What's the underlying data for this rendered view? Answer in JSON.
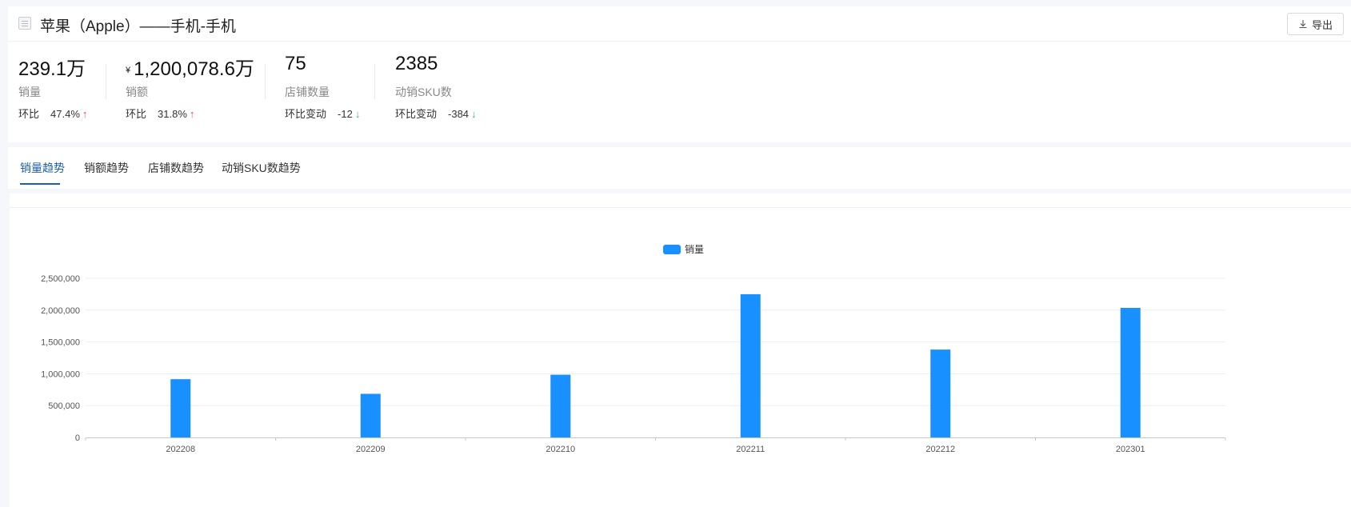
{
  "header": {
    "title": "苹果（Apple）——手机-手机",
    "export_label": "导出"
  },
  "metrics": [
    {
      "value": "239.1万",
      "label": "销量",
      "compare_label": "环比",
      "compare_value": "47.4%",
      "direction": "up"
    },
    {
      "currency": "¥",
      "value": "1,200,078.6万",
      "label": "销额",
      "compare_label": "环比",
      "compare_value": "31.8%",
      "direction": "up"
    },
    {
      "value": "75",
      "label": "店铺数量",
      "compare_label": "环比变动",
      "compare_value": "-12",
      "direction": "down"
    },
    {
      "value": "2385",
      "label": "动销SKU数",
      "compare_label": "环比变动",
      "compare_value": "-384",
      "direction": "down"
    }
  ],
  "tabs": [
    {
      "label": "销量趋势",
      "active": true
    },
    {
      "label": "销额趋势",
      "active": false
    },
    {
      "label": "店铺数趋势",
      "active": false
    },
    {
      "label": "动销SKU数趋势",
      "active": false
    }
  ],
  "colors": {
    "accent": "#1890ff",
    "tab_active": "#1a5fb4",
    "up": "#f5484f",
    "down": "#2fbf6a"
  },
  "chart_data": {
    "type": "bar",
    "categories": [
      "202208",
      "202209",
      "202210",
      "202211",
      "202212",
      "202301"
    ],
    "series": [
      {
        "name": "销量",
        "values": [
          915000,
          685000,
          985000,
          2250000,
          1380000,
          2035000
        ]
      }
    ],
    "ylim": [
      0,
      2500000
    ],
    "yticks": [
      0,
      500000,
      1000000,
      1500000,
      2000000,
      2500000
    ],
    "ytick_labels": [
      "0",
      "500,000",
      "1,000,000",
      "1,500,000",
      "2,000,000",
      "2,500,000"
    ],
    "grid": true,
    "legend_position": "top-center"
  }
}
